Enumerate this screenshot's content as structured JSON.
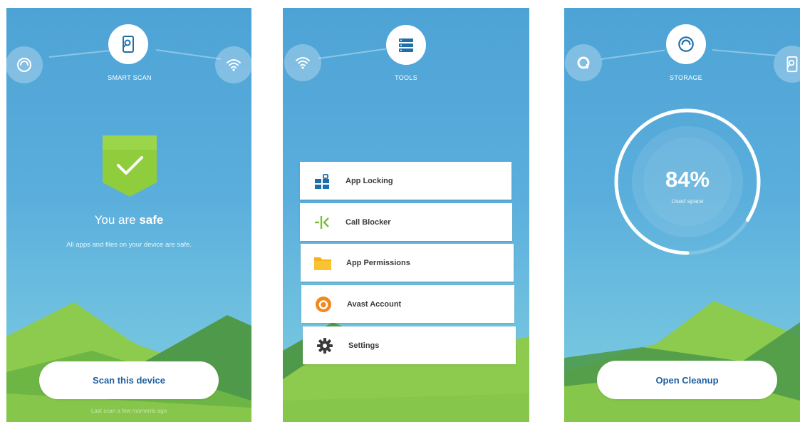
{
  "screen1": {
    "nav_label": "SMART SCAN",
    "nav_icons": [
      "swirl-icon",
      "phone-search-icon",
      "wifi-icon"
    ],
    "status_text_prefix": "You are",
    "status_text_bold": "safe",
    "status_subtitle": "All apps and files on your device are safe.",
    "button_label": "Scan this device",
    "last_scan_text": "Last scan a few moments ago"
  },
  "screen2": {
    "nav_label": "TOOLS",
    "nav_icons": [
      "wifi-icon",
      "tools-list-icon"
    ],
    "tools": [
      {
        "label": "App Locking",
        "icon": "app-lock-icon"
      },
      {
        "label": "Call Blocker",
        "icon": "call-blocker-icon"
      },
      {
        "label": "App Permissions",
        "icon": "folder-icon"
      },
      {
        "label": "Avast Account",
        "icon": "avast-logo-icon"
      },
      {
        "label": "Settings",
        "icon": "gear-icon"
      }
    ]
  },
  "screen3": {
    "nav_label": "STORAGE",
    "nav_icons": [
      "avast-logo-icon",
      "swirl-icon",
      "phone-search-icon"
    ],
    "percent_text": "84%",
    "percent_value": 84,
    "percent_caption": "Used space",
    "button_label": "Open Cleanup"
  },
  "colors": {
    "sky": "#4ea3d6",
    "button_text": "#1d5f9d",
    "shield_green": "#8fcd3d",
    "hill_dark": "#4f9a4a",
    "hill_light": "#8ccb4d",
    "tool_blue": "#1e6fa8",
    "tool_green": "#7bbd3b",
    "tool_yellow": "#f5b21a",
    "avast_orange": "#f0891f"
  }
}
